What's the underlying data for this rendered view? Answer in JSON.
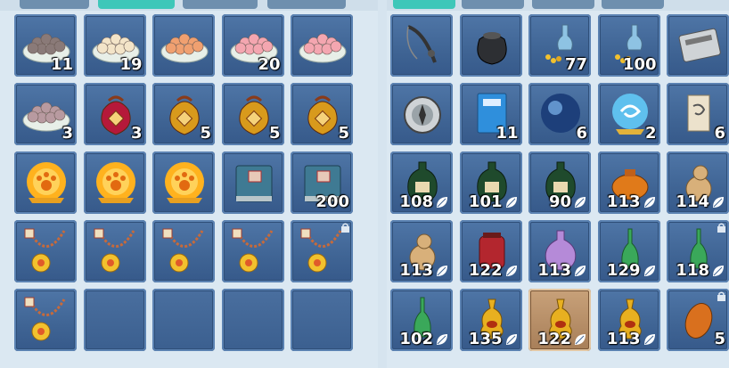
{
  "colors": {
    "tab_active": "#3ec7b9",
    "tab_inactive": "#6e8fae",
    "slot_bg": "#3f6494",
    "slot_selected": "#b08a64"
  },
  "left_inventory": [
    {
      "icon": "dumpling-plate-dark-icon",
      "qty": "11"
    },
    {
      "icon": "dumpling-plate-white-icon",
      "qty": "19"
    },
    {
      "icon": "dumpling-plate-orange-icon",
      "qty": ""
    },
    {
      "icon": "dumpling-plate-pink-icon",
      "qty": "20"
    },
    {
      "icon": "dumpling-plate-pink-icon",
      "qty": ""
    },
    {
      "icon": "dumpling-plate-mauve-icon",
      "qty": "3"
    },
    {
      "icon": "red-lucky-bag-icon",
      "qty": "3"
    },
    {
      "icon": "gold-lucky-bag-icon",
      "qty": "5"
    },
    {
      "icon": "gold-lucky-bag-icon",
      "qty": "5"
    },
    {
      "icon": "gold-lucky-bag-icon",
      "qty": "5"
    },
    {
      "icon": "glowing-paw-orb-icon",
      "qty": ""
    },
    {
      "icon": "glowing-paw-orb-icon",
      "qty": ""
    },
    {
      "icon": "glowing-paw-orb-icon",
      "qty": ""
    },
    {
      "icon": "blue-book-icon",
      "qty": ""
    },
    {
      "icon": "blue-book-icon",
      "qty": "200"
    },
    {
      "icon": "gold-pendant-necklace-icon",
      "qty": ""
    },
    {
      "icon": "gold-pendant-necklace-icon",
      "qty": ""
    },
    {
      "icon": "gold-pendant-necklace-icon",
      "qty": ""
    },
    {
      "icon": "gold-pendant-necklace-icon",
      "qty": ""
    },
    {
      "icon": "gold-pendant-necklace-icon",
      "qty": "",
      "locked": true
    },
    {
      "icon": "gold-pendant-necklace-icon",
      "qty": ""
    },
    {
      "icon": "",
      "qty": ""
    },
    {
      "icon": "",
      "qty": ""
    },
    {
      "icon": "",
      "qty": ""
    },
    {
      "icon": "",
      "qty": ""
    }
  ],
  "right_inventory": [
    {
      "icon": "fishing-rod-icon",
      "qty": ""
    },
    {
      "icon": "black-pouch-icon",
      "qty": ""
    },
    {
      "icon": "bait-bottle-icon",
      "qty": "77"
    },
    {
      "icon": "bait-bottle-icon",
      "qty": "100"
    },
    {
      "icon": "silver-tray-icon",
      "qty": ""
    },
    {
      "icon": "silver-compass-icon",
      "qty": ""
    },
    {
      "icon": "blue-manual-icon",
      "qty": "11"
    },
    {
      "icon": "blue-orb-icon",
      "qty": "6"
    },
    {
      "icon": "swirl-orb-icon",
      "qty": "2"
    },
    {
      "icon": "scroll-icon",
      "qty": "6"
    },
    {
      "icon": "green-potion-jar-icon",
      "qty": "108",
      "leaf": true
    },
    {
      "icon": "green-potion-jar-icon",
      "qty": "101",
      "leaf": true
    },
    {
      "icon": "green-potion-jar-icon",
      "qty": "90",
      "leaf": true
    },
    {
      "icon": "orange-jar-icon",
      "qty": "113",
      "leaf": true
    },
    {
      "icon": "clay-gourd-icon",
      "qty": "114",
      "leaf": true
    },
    {
      "icon": "clay-gourd-icon",
      "qty": "113",
      "leaf": true
    },
    {
      "icon": "red-jar-icon",
      "qty": "122",
      "leaf": true
    },
    {
      "icon": "purple-flask-icon",
      "qty": "113",
      "leaf": true
    },
    {
      "icon": "green-vial-icon",
      "qty": "129",
      "leaf": true
    },
    {
      "icon": "green-vial-icon",
      "qty": "118",
      "leaf": true,
      "locked": true
    },
    {
      "icon": "green-vial-icon",
      "qty": "102",
      "leaf": true
    },
    {
      "icon": "gold-vase-icon",
      "qty": "135",
      "leaf": true
    },
    {
      "icon": "gold-vase-icon",
      "qty": "122",
      "leaf": true,
      "selected": true
    },
    {
      "icon": "gold-vase-icon",
      "qty": "113",
      "leaf": true
    },
    {
      "icon": "amber-egg-icon",
      "qty": "5",
      "locked": true
    }
  ]
}
